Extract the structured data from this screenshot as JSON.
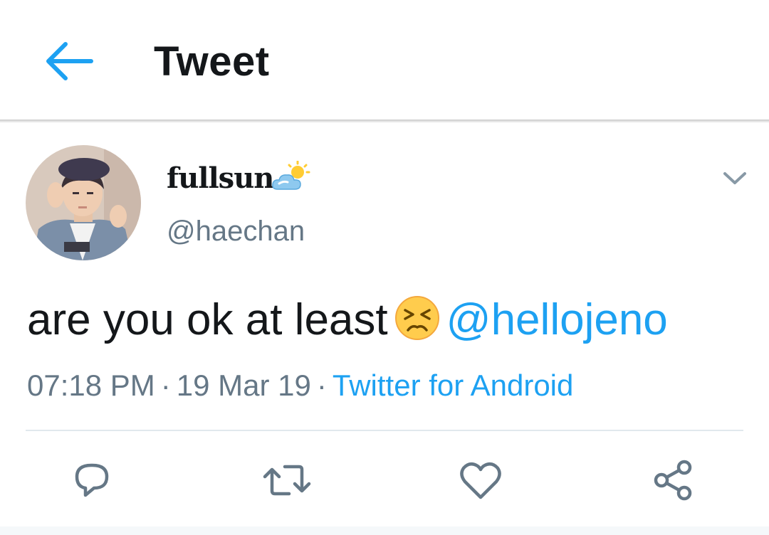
{
  "header": {
    "title": "Tweet",
    "back_icon": "arrow-left-icon",
    "accent_color": "#1da1f2"
  },
  "tweet": {
    "avatar_icon": "user-avatar",
    "display_name": "fullsun",
    "name_emoji_icon": "sun-behind-cloud-icon",
    "handle": "@haechan",
    "caret_icon": "chevron-down-icon",
    "text_before": "are you ok at least",
    "text_emoji_icon": "persevering-face-emoji",
    "mention": "@hellojeno",
    "time": "07:18 PM",
    "separator": "·",
    "date": "19 Mar 19",
    "source": "Twitter for Android"
  },
  "actions": [
    {
      "name": "reply",
      "icon": "speech-bubble-icon"
    },
    {
      "name": "retweet",
      "icon": "retweet-icon"
    },
    {
      "name": "like",
      "icon": "heart-icon"
    },
    {
      "name": "share",
      "icon": "share-icon"
    }
  ],
  "colors": {
    "link": "#1da1f2",
    "secondary_text": "#657786",
    "primary_text": "#14171a",
    "divider": "#e1e8ed"
  }
}
